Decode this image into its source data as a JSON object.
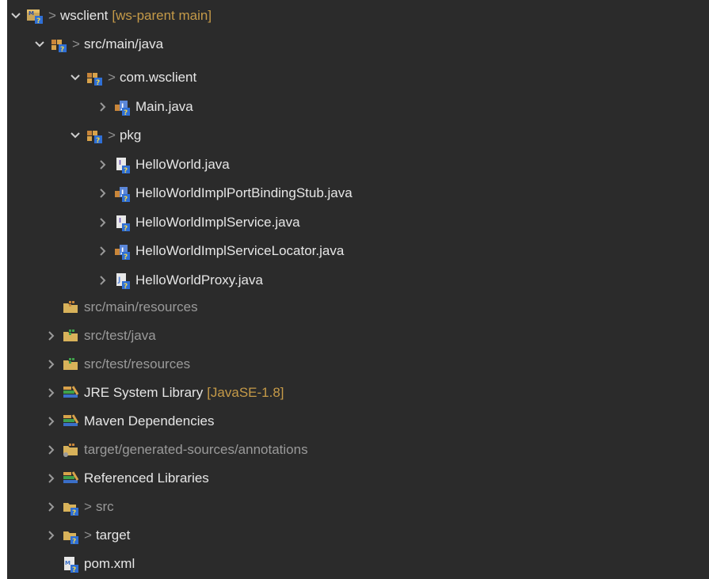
{
  "tree": {
    "root": {
      "prefix": ">",
      "label": "wsclient",
      "decoration": "[ws-parent main]"
    },
    "src_main_java": {
      "prefix": ">",
      "label": "src/main/java"
    },
    "pkg_com_wsclient": {
      "prefix": ">",
      "label": "com.wsclient"
    },
    "main_java": {
      "label": "Main.java"
    },
    "pkg_pkg": {
      "prefix": ">",
      "label": "pkg"
    },
    "helloworld_java": {
      "label": "HelloWorld.java"
    },
    "port_binding_stub": {
      "label": "HelloWorldImplPortBindingStub.java"
    },
    "impl_service": {
      "label": "HelloWorldImplService.java"
    },
    "impl_service_locator": {
      "label": "HelloWorldImplServiceLocator.java"
    },
    "proxy": {
      "label": "HelloWorldProxy.java"
    },
    "src_main_resources": {
      "label": "src/main/resources"
    },
    "src_test_java": {
      "label": "src/test/java"
    },
    "src_test_resources": {
      "label": "src/test/resources"
    },
    "jre_library": {
      "label": "JRE System Library",
      "decoration": "[JavaSE-1.8]"
    },
    "maven_deps": {
      "label": "Maven Dependencies"
    },
    "generated_sources": {
      "label": "target/generated-sources/annotations"
    },
    "referenced_libs": {
      "label": "Referenced Libraries"
    },
    "src_folder": {
      "prefix": ">",
      "label": "src"
    },
    "target_folder": {
      "prefix": ">",
      "label": "target"
    },
    "pom": {
      "label": "pom.xml"
    }
  },
  "colors": {
    "background": "#2b2b2b",
    "text": "#e6e6e6",
    "dim_text": "#9a9a9a",
    "decoration": "#c59a48",
    "prefix": "#8f8f8f"
  }
}
